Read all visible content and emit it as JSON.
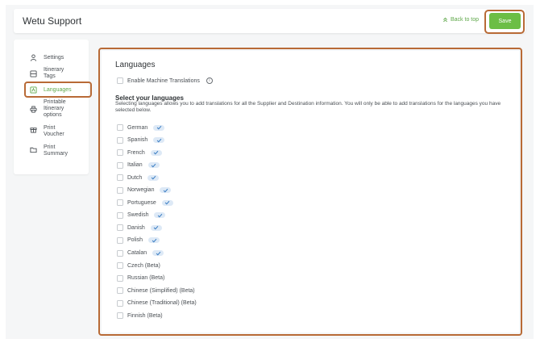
{
  "app": {
    "title": "Wetu Support"
  },
  "header": {
    "back_to_top": "Back to top",
    "save_label": "Save"
  },
  "sidebar": {
    "items": [
      {
        "label": "Settings",
        "icon": "user-icon",
        "active": false
      },
      {
        "label": "Itinerary\nTags",
        "icon": "tag-icon",
        "active": false
      },
      {
        "label": "Languages",
        "icon": "languages-icon",
        "active": true
      },
      {
        "label": "Printable\nItinerary\noptions",
        "icon": "printer-icon",
        "active": false
      },
      {
        "label": "Print\nVoucher",
        "icon": "gift-icon",
        "active": false
      },
      {
        "label": "Print\nSummary",
        "icon": "folder-icon",
        "active": false
      }
    ]
  },
  "main": {
    "heading": "Languages",
    "machine_translations_label": "Enable Machine Translations",
    "select_title": "Select your languages",
    "select_description": "Selecting languages allows you to add translations for all the Supplier and Destination information. You will only be able to add translations for the languages you have selected below.",
    "languages": [
      {
        "name": "German",
        "available": true
      },
      {
        "name": "Spanish",
        "available": true
      },
      {
        "name": "French",
        "available": true
      },
      {
        "name": "Italian",
        "available": true
      },
      {
        "name": "Dutch",
        "available": true
      },
      {
        "name": "Norwegian",
        "available": true
      },
      {
        "name": "Portuguese",
        "available": true
      },
      {
        "name": "Swedish",
        "available": true
      },
      {
        "name": "Danish",
        "available": true
      },
      {
        "name": "Polish",
        "available": true
      },
      {
        "name": "Catalan",
        "available": true
      },
      {
        "name": "Czech (Beta)",
        "available": false
      },
      {
        "name": "Russian (Beta)",
        "available": false
      },
      {
        "name": "Chinese (Simplified) (Beta)",
        "available": false
      },
      {
        "name": "Chinese (Traditional) (Beta)",
        "available": false
      },
      {
        "name": "Finnish (Beta)",
        "available": false
      }
    ]
  },
  "colors": {
    "accent": "#6cbe45",
    "highlight": "#b86a36",
    "tick_bg": "#dde9f6"
  }
}
